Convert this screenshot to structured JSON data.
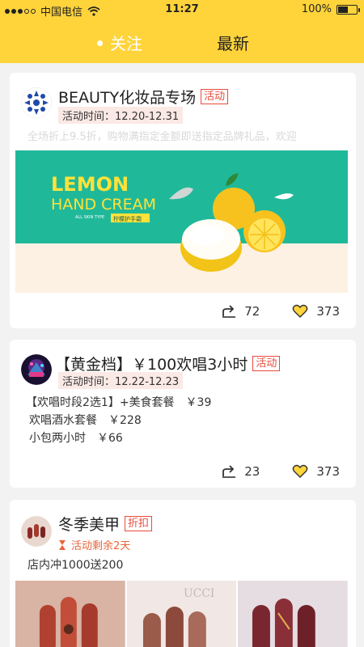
{
  "status": {
    "carrier": "中国电信",
    "time": "11:27",
    "battery": "100%"
  },
  "tabs": {
    "follow": "关注",
    "latest": "最新"
  },
  "posts": [
    {
      "title": "BEAUTY化妆品专场",
      "badge": "活动",
      "time": "活动时间：12.20-12.31",
      "desc": "全场折上9.5折，购物满指定金额即送指定品牌礼品，欢迎",
      "banner_title1": "LEMON",
      "banner_title2": "HAND CREAM",
      "banner_sub": "ALL SKIN TYPE",
      "banner_tag": "柠檬护手霜",
      "shares": "72",
      "likes": "373"
    },
    {
      "title": "【黄金档】￥100欢唱3小时",
      "badge": "活动",
      "time": "活动时间：12.22-12.23",
      "lines": [
        "【欢唱时段2选1】+美食套餐　￥39",
        "欢唱酒水套餐　￥228",
        "小包两小时　￥66"
      ],
      "shares": "23",
      "likes": "373"
    },
    {
      "title": "冬季美甲",
      "badge": "折扣",
      "countdown": "活动剩余2天",
      "desc": "店内冲1000送200"
    }
  ],
  "colors": {
    "header": "#ffd43b",
    "badge": "#e84b3c",
    "banner_teal": "#1fb99a"
  }
}
